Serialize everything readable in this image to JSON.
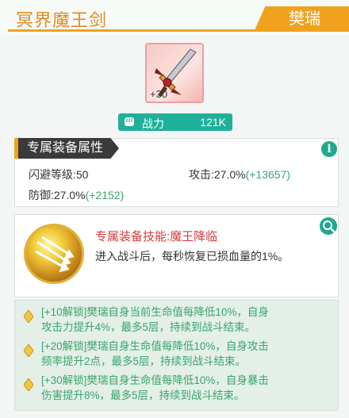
{
  "header": {
    "title": "冥界魔王剑",
    "owner": "樊瑞",
    "accent_color": "#f0a21f"
  },
  "item": {
    "level_badge": "+30",
    "icon": "sword-item-icon"
  },
  "power": {
    "label": "战力",
    "value": "121K",
    "icon": "fist-icon"
  },
  "attributes": {
    "section_title": "专属装备属性",
    "info_icon": "info-icon",
    "dodge": {
      "label": "闪避等级:50"
    },
    "attack": {
      "label": "攻击:27.0%",
      "bonus": "(+13657)"
    },
    "defense": {
      "label": "防御:27.0%",
      "bonus": "(+2152)"
    }
  },
  "skill": {
    "title": "专属装备技能:魔王降临",
    "description": "进入战斗后，每秒恢复已损血量的1%。",
    "icon": "skill-arrows-icon",
    "zoom_icon": "magnifier-icon"
  },
  "unlocks": [
    {
      "line1": "[+10解锁]樊瑞自身当前生命值每降低10%，自身",
      "line2": "攻击力提升4%，最多5层，持续到战斗结束。"
    },
    {
      "line1": "[+20解锁]樊瑞自身生命值每降低10%，自身攻击",
      "line2": "频率提升2点，最多5层，持续到战斗结束。"
    },
    {
      "line1": "[+30解锁]樊瑞自身生命值每降低10%，自身暴击",
      "line2": "伤害提升8%，最多5层，持续到战斗结束。"
    }
  ]
}
